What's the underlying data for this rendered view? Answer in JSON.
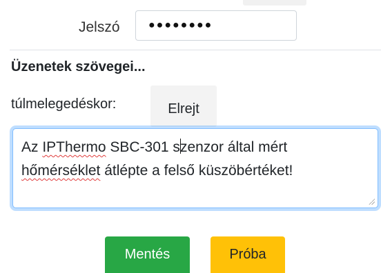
{
  "password": {
    "label": "Jelszó",
    "masked_value": "●●●●●●●●"
  },
  "messages": {
    "heading": "Üzenetek szövegei...",
    "overheat_label": "túlmelegedéskor:",
    "hide_button": "Elrejt",
    "overheat_text": {
      "part1": "Az ",
      "misspelled": "IPThermo",
      "part2": " SBC-301 s",
      "part3": "zenzor által mért",
      "line2_misspelled": "hőmérséklet",
      "line2_rest": " átlépte a felső küszöbértéket!"
    }
  },
  "actions": {
    "save_label": "Mentés",
    "test_label": "Próba"
  },
  "colors": {
    "save": "#28a745",
    "test": "#ffc107",
    "focus": "#80bdff"
  }
}
